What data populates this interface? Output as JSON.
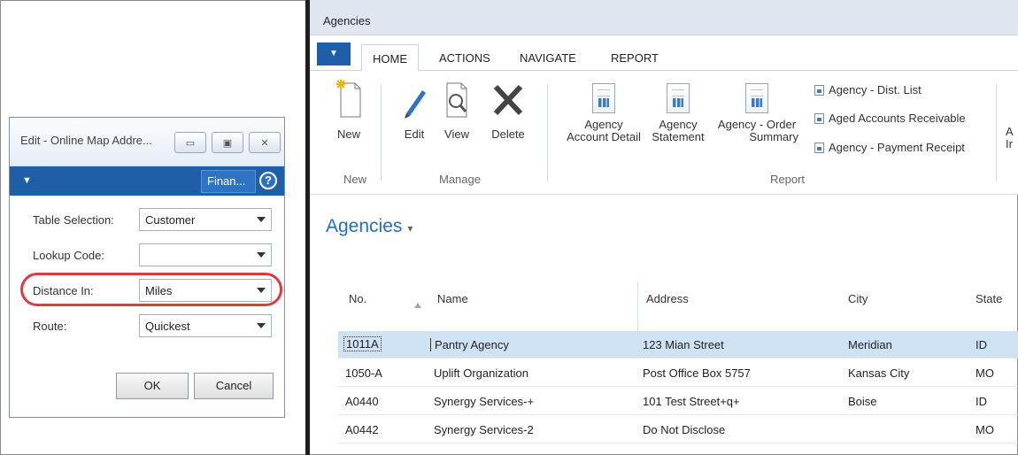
{
  "dialog": {
    "title": "Edit - Online Map Addre...",
    "fin_button": "Finan...",
    "help": "?",
    "fields": [
      {
        "label": "Table Selection:",
        "value": "Customer"
      },
      {
        "label": "Lookup Code:",
        "value": ""
      },
      {
        "label": "Distance In:",
        "value": "Miles"
      },
      {
        "label": "Route:",
        "value": "Quickest"
      }
    ],
    "ok": "OK",
    "cancel": "Cancel"
  },
  "app": {
    "title": "Agencies",
    "tabs": [
      "HOME",
      "ACTIONS",
      "NAVIGATE",
      "REPORT"
    ],
    "ribbon": {
      "new": "New",
      "edit": "Edit",
      "view": "View",
      "delete": "Delete",
      "group_new": "New",
      "group_manage": "Manage",
      "group_report": "Report",
      "reports": [
        {
          "line1": "Agency",
          "line2": "Account Detail"
        },
        {
          "line1": "Agency",
          "line2": "Statement"
        },
        {
          "line1": "Agency - Order",
          "line2": "Summary"
        }
      ],
      "small_reports": [
        "Agency - Dist. List",
        "Aged Accounts Receivable",
        "Agency - Payment Receipt"
      ],
      "cut_label_1": "A",
      "cut_label_2": "Ir"
    },
    "page_title": "Agencies",
    "page_title_chevron": "▾"
  },
  "table": {
    "columns": [
      "No.",
      "Name",
      "Address",
      "City",
      "State"
    ],
    "rows": [
      {
        "no": "1011A",
        "name": "Pantry Agency",
        "address": "123 Mian Street",
        "city": "Meridian",
        "state": "ID"
      },
      {
        "no": "1050-A",
        "name": "Uplift Organization",
        "address": "Post Office Box 5757",
        "city": "Kansas City",
        "state": "MO"
      },
      {
        "no": "A0440",
        "name": "Synergy Services-+",
        "address": "101 Test Street+q+",
        "city": "Boise",
        "state": "ID"
      },
      {
        "no": "A0442",
        "name": "Synergy Services-2",
        "address": "Do Not Disclose",
        "city": "",
        "state": "MO"
      }
    ]
  },
  "colors": {
    "accent": "#1f5fa8",
    "highlight": "#e0393e",
    "selected_row": "#cfe2f4"
  }
}
